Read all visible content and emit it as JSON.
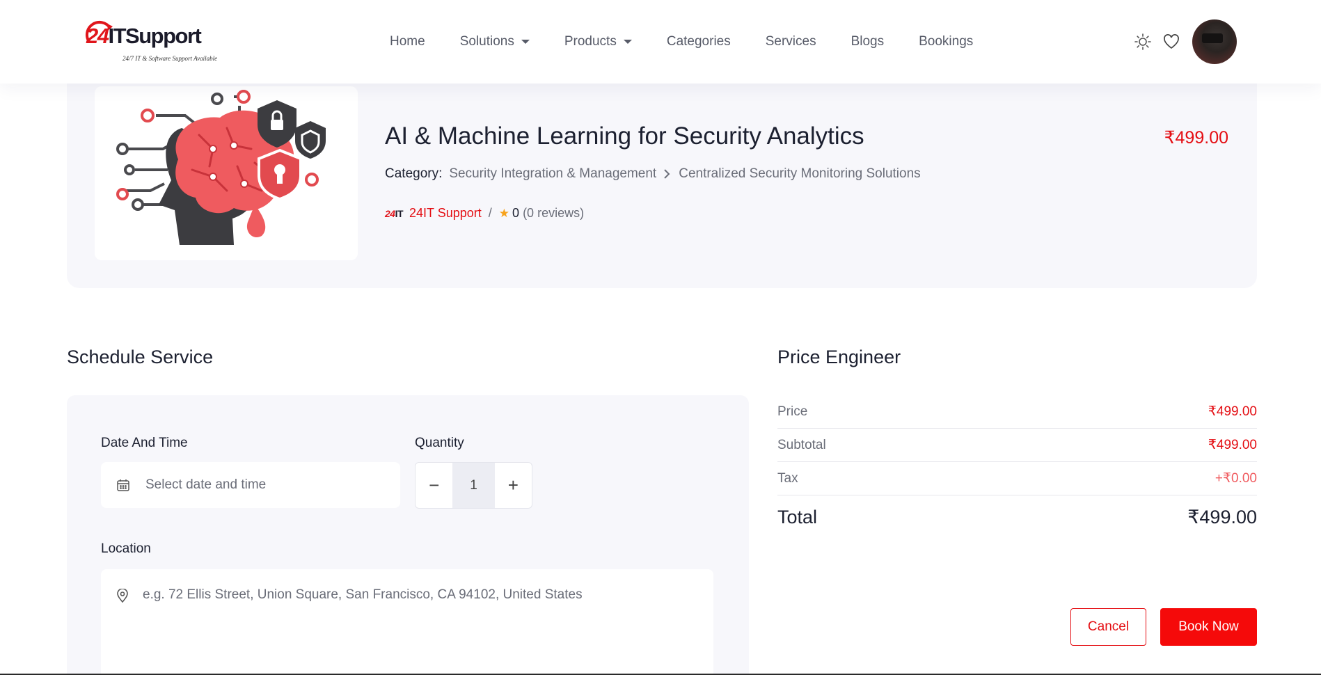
{
  "header": {
    "logo": {
      "num": "24",
      "text": "ITSupport",
      "tagline": "24/7 IT & Software Support Available"
    },
    "nav": [
      {
        "label": "Home",
        "dropdown": false
      },
      {
        "label": "Solutions",
        "dropdown": true
      },
      {
        "label": "Products",
        "dropdown": true
      },
      {
        "label": "Categories",
        "dropdown": false
      },
      {
        "label": "Services",
        "dropdown": false
      },
      {
        "label": "Blogs",
        "dropdown": false
      },
      {
        "label": "Bookings",
        "dropdown": false
      }
    ],
    "icons": {
      "theme": "sun-icon",
      "wishlist": "heart-icon",
      "avatar": "user-avatar"
    }
  },
  "product": {
    "title": "AI & Machine Learning for Security Analytics",
    "price": "₹499.00",
    "category_label": "Category:",
    "category": "Security Integration & Management",
    "subcategory": "Centralized Security Monitoring Solutions",
    "vendor_logo": {
      "num": "24",
      "text": "IT"
    },
    "vendor": "24IT Support",
    "separator": "/",
    "rating": "0",
    "reviews": "(0 reviews)"
  },
  "schedule": {
    "title": "Schedule Service",
    "date_label": "Date And Time",
    "date_placeholder": "Select date and time",
    "quantity_label": "Quantity",
    "quantity": "1",
    "minus": "−",
    "plus": "+",
    "location_label": "Location",
    "location_placeholder": "e.g. 72 Ellis Street, Union Square, San Francisco, CA 94102, United States"
  },
  "pricing": {
    "title": "Price Engineer",
    "rows": [
      {
        "label": "Price",
        "value": "₹499.00"
      },
      {
        "label": "Subtotal",
        "value": "₹499.00"
      },
      {
        "label": "Tax",
        "value": "+₹0.00"
      }
    ],
    "total_label": "Total",
    "total_value": "₹499.00",
    "cancel": "Cancel",
    "book": "Book Now"
  },
  "colors": {
    "accent": "#e40d12",
    "card_bg": "#f7f7fb",
    "text": "#1c2030",
    "muted": "#6a6d78"
  }
}
